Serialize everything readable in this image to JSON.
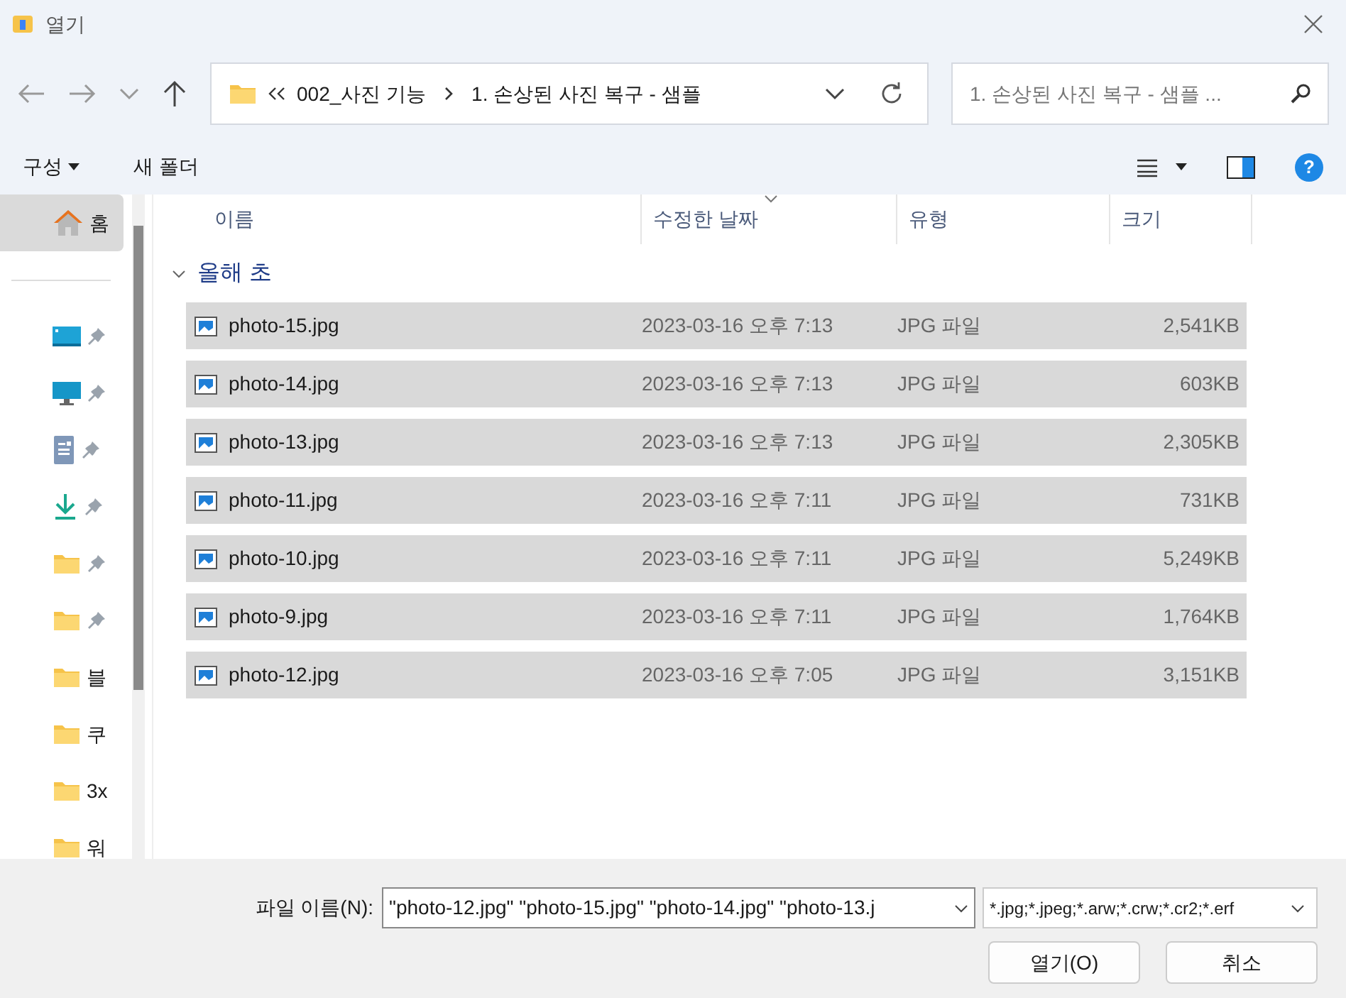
{
  "window": {
    "title": "열기"
  },
  "address": {
    "path": [
      {
        "label": "002_사진 기능"
      },
      {
        "label": "1. 손상된 사진 복구 - 샘플"
      }
    ]
  },
  "search": {
    "placeholder": "1. 손상된 사진 복구 - 샘플 ..."
  },
  "toolbar": {
    "organize": "구성",
    "new_folder": "새 폴더",
    "help": "?"
  },
  "sidebar": {
    "items": [
      {
        "kind": "home",
        "label": "홈",
        "selected": true,
        "pinned": false
      },
      {
        "kind": "desktop",
        "pinned": true,
        "selected": false
      },
      {
        "kind": "monitor",
        "pinned": true,
        "selected": false
      },
      {
        "kind": "document",
        "pinned": true,
        "selected": false
      },
      {
        "kind": "download",
        "pinned": true,
        "selected": false
      },
      {
        "kind": "folder",
        "pinned": true,
        "selected": false
      },
      {
        "kind": "folder",
        "pinned": true,
        "selected": false
      },
      {
        "kind": "folder",
        "label": "블",
        "pinned": false,
        "selected": false
      },
      {
        "kind": "folder",
        "label": "쿠",
        "pinned": false,
        "selected": false
      },
      {
        "kind": "folder",
        "label": "3x",
        "pinned": false,
        "selected": false
      },
      {
        "kind": "folder",
        "label": "워",
        "pinned": false,
        "selected": false
      }
    ]
  },
  "table": {
    "columns": [
      "이름",
      "수정한 날짜",
      "유형",
      "크기"
    ],
    "group": "올해 초",
    "rows": [
      {
        "name": "photo-15.jpg",
        "date": "2023-03-16 오후 7:13",
        "type": "JPG 파일",
        "size": "2,541KB",
        "selected": true
      },
      {
        "name": "photo-14.jpg",
        "date": "2023-03-16 오후 7:13",
        "type": "JPG 파일",
        "size": "603KB",
        "selected": true
      },
      {
        "name": "photo-13.jpg",
        "date": "2023-03-16 오후 7:13",
        "type": "JPG 파일",
        "size": "2,305KB",
        "selected": true
      },
      {
        "name": "photo-11.jpg",
        "date": "2023-03-16 오후 7:11",
        "type": "JPG 파일",
        "size": "731KB",
        "selected": true
      },
      {
        "name": "photo-10.jpg",
        "date": "2023-03-16 오후 7:11",
        "type": "JPG 파일",
        "size": "5,249KB",
        "selected": true
      },
      {
        "name": "photo-9.jpg",
        "date": "2023-03-16 오후 7:11",
        "type": "JPG 파일",
        "size": "1,764KB",
        "selected": true
      },
      {
        "name": "photo-12.jpg",
        "date": "2023-03-16 오후 7:05",
        "type": "JPG 파일",
        "size": "3,151KB",
        "selected": true
      }
    ]
  },
  "footer": {
    "filename_label": "파일 이름(N):",
    "filename": "\"photo-12.jpg\" \"photo-15.jpg\" \"photo-14.jpg\" \"photo-13.j",
    "filter": "*.jpg;*.jpeg;*.arw;*.crw;*.cr2;*.erf",
    "open": "열기(O)",
    "cancel": "취소"
  }
}
